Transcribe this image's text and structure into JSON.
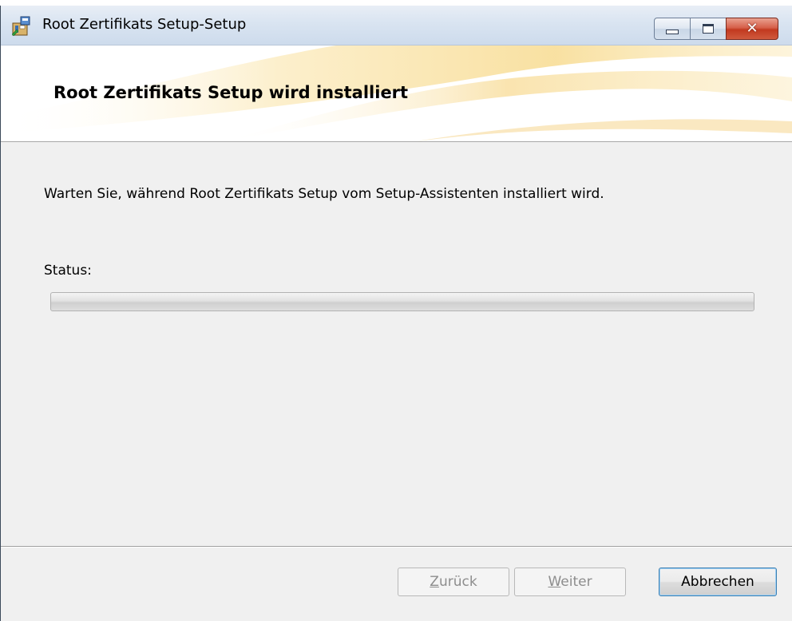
{
  "window": {
    "title": "Root Zertifikats Setup-Setup"
  },
  "caption_buttons": {
    "minimize_icon": "minimize-icon",
    "maximize_icon": "maximize-icon",
    "close_icon": "close-icon",
    "close_glyph": "✕",
    "close_color": "#c7432a"
  },
  "banner": {
    "heading": "Root Zertifikats Setup wird installiert"
  },
  "body": {
    "description": "Warten Sie, während Root Zertifikats Setup vom Setup-Assistenten installiert wird.",
    "status_label": "Status:",
    "progress_fraction": 0
  },
  "footer": {
    "back_label": "Zurück",
    "back_mnemonic": "Z",
    "back_rest": "urück",
    "next_label": "Weiter",
    "next_mnemonic": "W",
    "next_rest": "eiter",
    "cancel_label": "Abbrechen",
    "back_enabled": false,
    "next_enabled": false
  }
}
